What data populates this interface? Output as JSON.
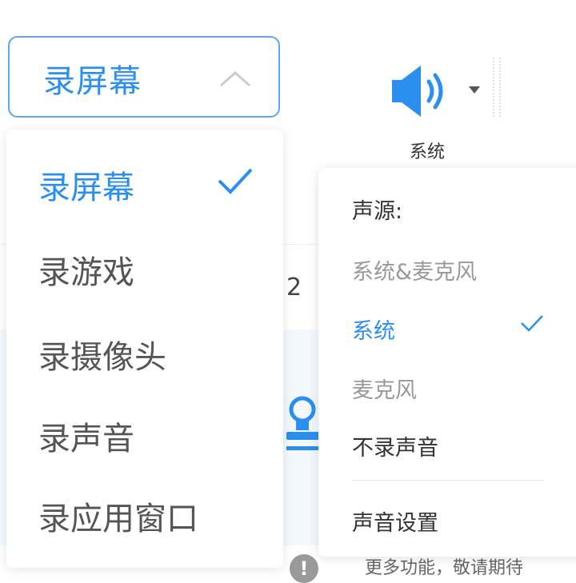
{
  "background": {
    "partial_number": "2",
    "footer_text": "更多功能，敬请期待",
    "warning_glyph": "!"
  },
  "mode_select": {
    "value": "录屏幕",
    "icon": "chevron-up-icon",
    "accent": "#2b8ff0"
  },
  "mode_menu": {
    "items": [
      {
        "label": "录屏幕",
        "selected": true
      },
      {
        "label": "录游戏",
        "selected": false
      },
      {
        "label": "录摄像头",
        "selected": false
      },
      {
        "label": "录声音",
        "selected": false
      },
      {
        "label": "录应用窗口",
        "selected": false
      }
    ]
  },
  "audio_control": {
    "label": "系统",
    "icon": "speaker-icon",
    "caret_icon": "caret-down-icon"
  },
  "audio_menu": {
    "title": "声源:",
    "items": [
      {
        "label": "系统&麦克风",
        "state": "disabled"
      },
      {
        "label": "系统",
        "state": "selected"
      },
      {
        "label": "麦克风",
        "state": "disabled"
      },
      {
        "label": "不录声音",
        "state": "normal"
      }
    ],
    "settings_label": "声音设置"
  }
}
